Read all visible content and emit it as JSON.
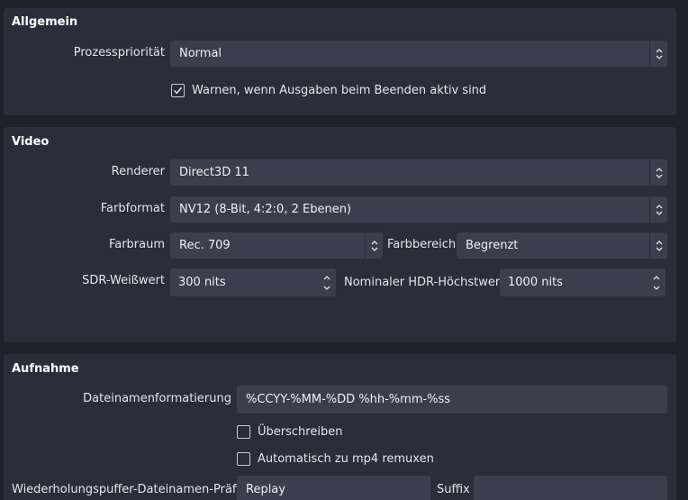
{
  "general": {
    "title": "Allgemein",
    "priority_label": "Prozesspriorität",
    "priority_value": "Normal",
    "warn_label": "Warnen, wenn Ausgaben beim Beenden aktiv sind",
    "warn_checked": true
  },
  "video": {
    "title": "Video",
    "renderer_label": "Renderer",
    "renderer_value": "Direct3D 11",
    "color_format_label": "Farbformat",
    "color_format_value": "NV12 (8-Bit, 4:2:0, 2 Ebenen)",
    "color_space_label": "Farbraum",
    "color_space_value": "Rec. 709",
    "color_range_label": "Farbbereich",
    "color_range_value": "Begrenzt",
    "sdr_white_label": "SDR-Weißwert",
    "sdr_white_value": "300 nits",
    "hdr_peak_label": "Nominaler HDR-Höchstwert",
    "hdr_peak_value": "1000 nits"
  },
  "recording": {
    "title": "Aufnahme",
    "filename_format_label": "Dateinamenformatierung",
    "filename_format_value": "%CCYY-%MM-%DD %hh-%mm-%ss",
    "overwrite_label": "Überschreiben",
    "overwrite_checked": false,
    "remux_label": "Automatisch zu mp4 remuxen",
    "remux_checked": false,
    "replay_prefix_label": "Wiederholungspuffer-Dateinamen-Präfix",
    "replay_prefix_value": "Replay",
    "suffix_label": "Suffix",
    "suffix_value": ""
  },
  "icons": {
    "combo": "updown-chevron-icon",
    "spin": "spin-arrows-icon",
    "check": "checkmark-icon"
  },
  "colors": {
    "background": "#1f212b",
    "group": "#2b2e3a",
    "field": "#3b3e4c",
    "text": "#e4e5ea"
  }
}
